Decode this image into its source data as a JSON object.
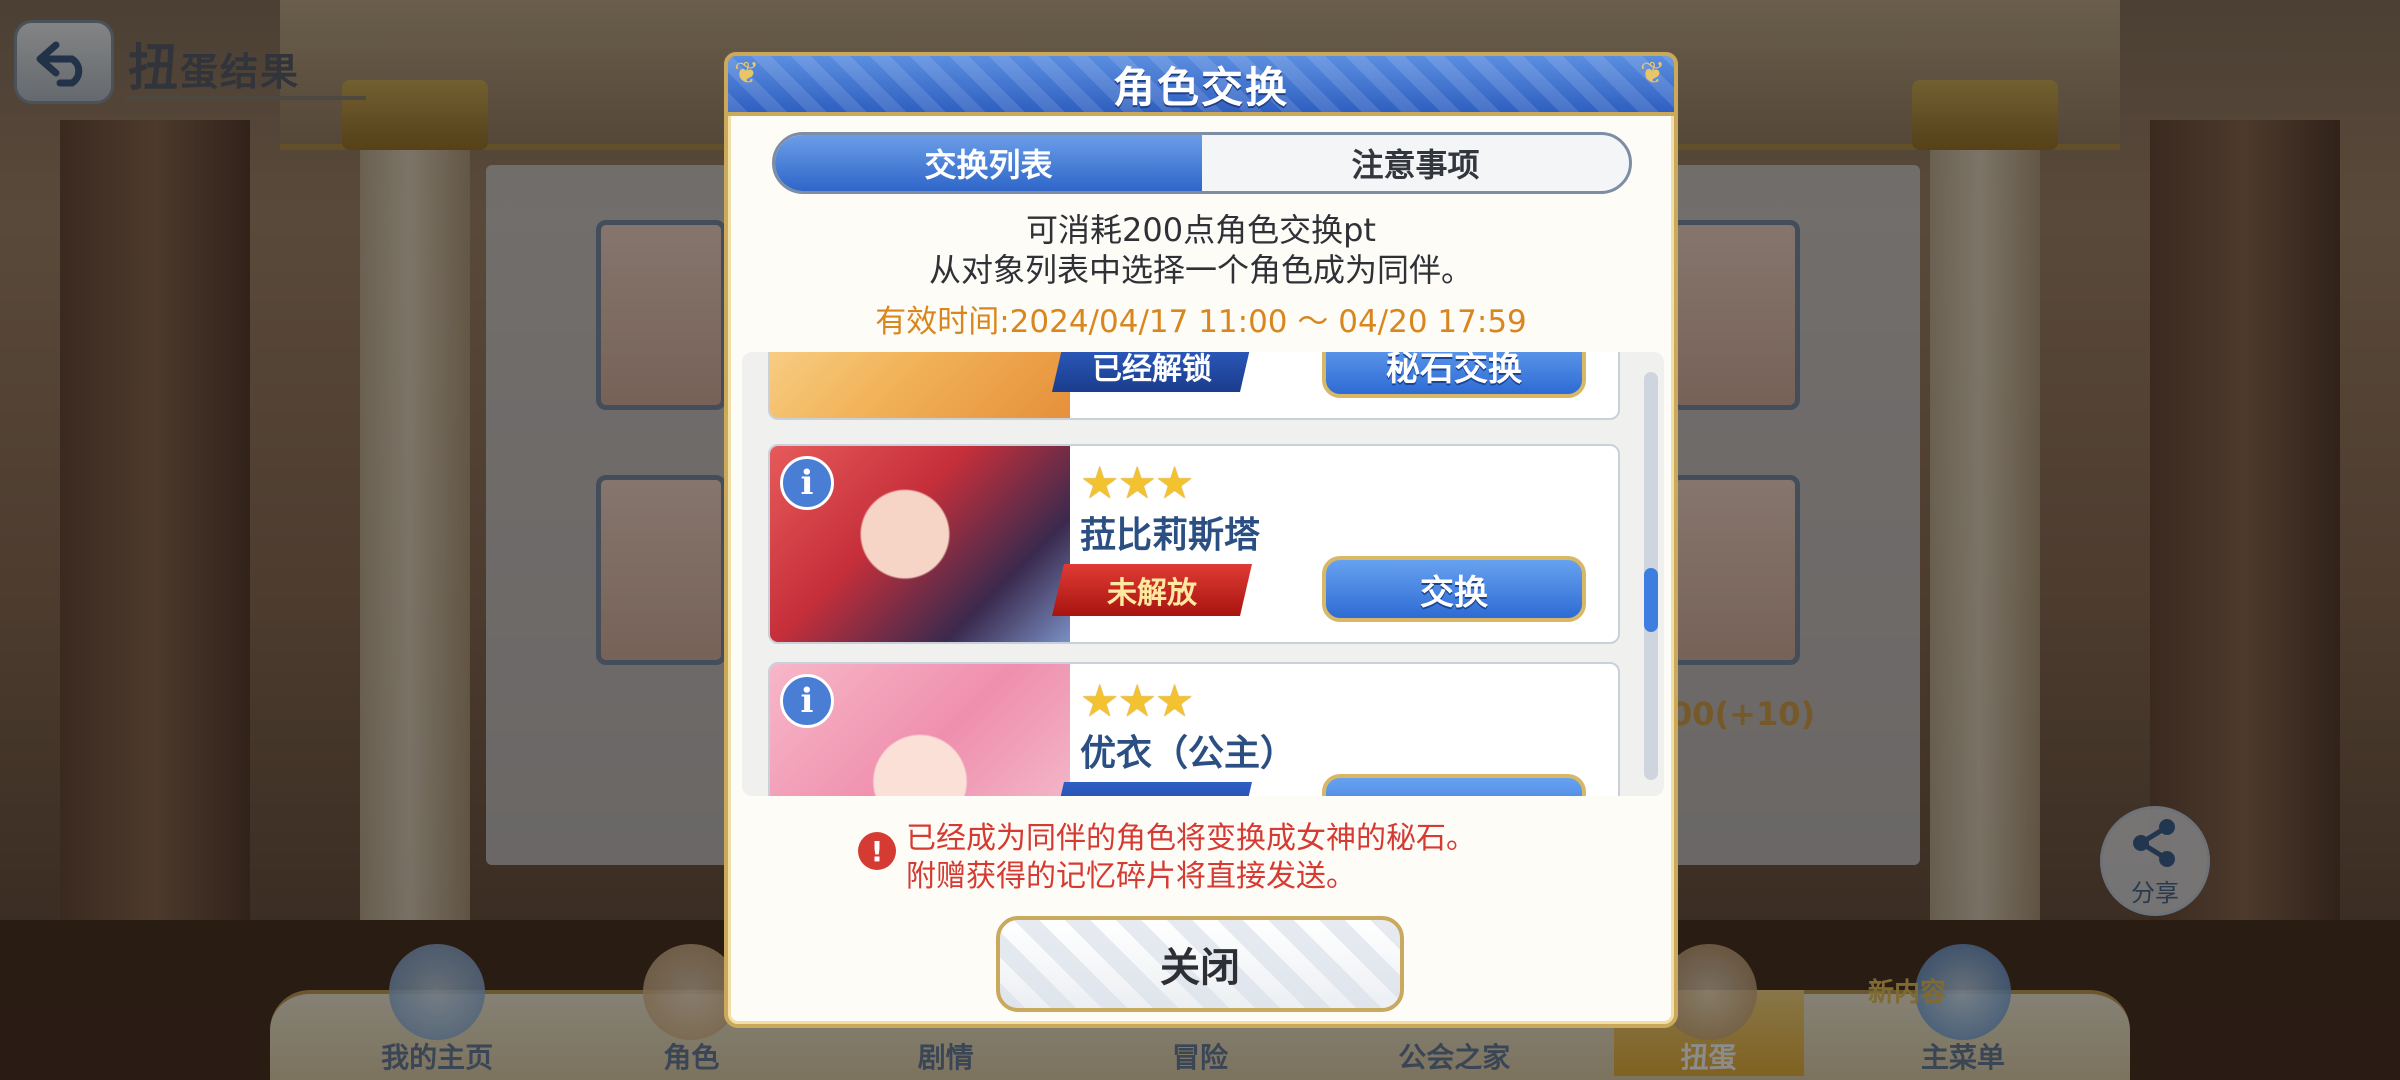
{
  "screen": {
    "title_big": "扭",
    "title_small": "蛋结果",
    "share_label": "分享"
  },
  "bottom_nav": {
    "items": [
      "我的主页",
      "角色",
      "剧情",
      "冒险",
      "公会之家",
      "扭蛋",
      "主菜单"
    ],
    "active_index": 5,
    "new_badge": "新内容"
  },
  "background": {
    "side_count_label": "00(+10)"
  },
  "modal": {
    "title": "角色交换",
    "tabs": [
      {
        "label": "交换列表",
        "active": true
      },
      {
        "label": "注意事项",
        "active": false
      }
    ],
    "description_line1": "可消耗200点角色交换pt",
    "description_line2": "从对象列表中选择一个角色成为同伴。",
    "period": "有效时间:2024/04/17 11:00 ～ 04/20 17:59",
    "list": [
      {
        "status": "已经解锁",
        "status_type": "unlocked",
        "action": "秘石交换"
      },
      {
        "stars": "★★★",
        "name": "菈比莉斯塔",
        "status": "未解放",
        "status_type": "locked",
        "action": "交换"
      },
      {
        "stars": "★★★",
        "name": "优衣（公主）",
        "status_type": "unlocked"
      }
    ],
    "notice_line1": "已经成为同伴的角色将变换成女神的秘石。",
    "notice_line2": "附赠获得的记忆碎片将直接发送。",
    "close_label": "关闭"
  },
  "colors": {
    "header_blue": "#2f5fc0",
    "gold_border": "#caa95a",
    "period_orange": "#d9861f",
    "notice_red": "#d53a33",
    "name_blue": "#2c4f83"
  }
}
